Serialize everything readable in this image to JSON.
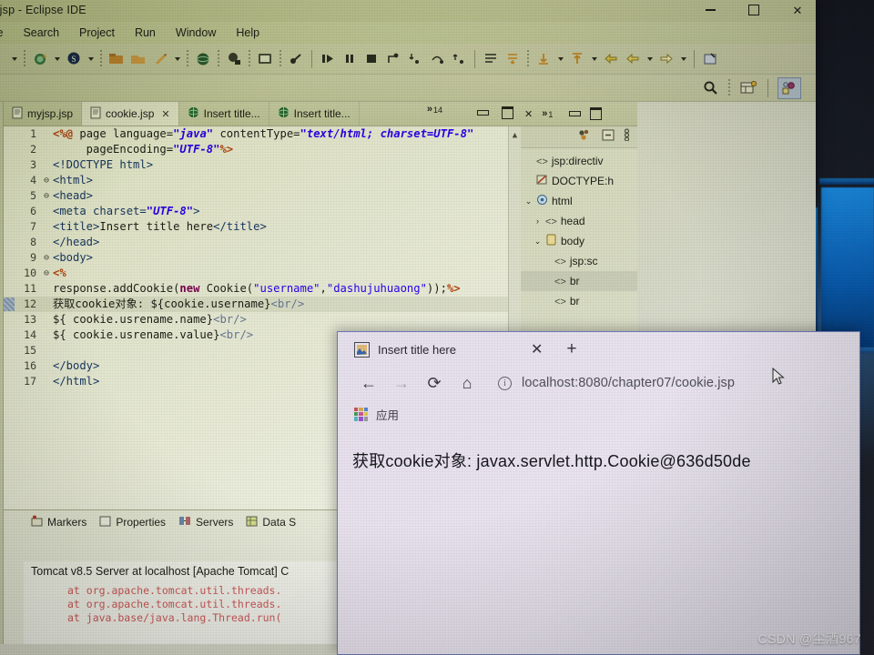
{
  "window": {
    "title": ".jsp - Eclipse IDE",
    "minimize_label": "Minimize",
    "maximize_label": "Maximize",
    "close_label": "✕"
  },
  "menu": {
    "items": [
      "te",
      "Search",
      "Project",
      "Run",
      "Window",
      "Help"
    ]
  },
  "perspective": {
    "search_icon": "search-icon",
    "open_perspective_icon": "open-perspective-icon",
    "active_perspective": "java-ee-perspective"
  },
  "editor": {
    "tabs": [
      {
        "label": "myjsp.jsp",
        "icon": "jsp-file-icon",
        "active": false,
        "closable": false
      },
      {
        "label": "cookie.jsp",
        "icon": "jsp-file-icon",
        "active": true,
        "closable": true,
        "close": "✕"
      },
      {
        "label": "Insert title...",
        "icon": "browser-globe-icon",
        "active": false,
        "closable": false
      },
      {
        "label": "Insert title...",
        "icon": "browser-globe-icon",
        "active": false,
        "closable": false
      }
    ],
    "overflow_chevron": "»",
    "overflow_count": "14",
    "lines": [
      {
        "n": "1",
        "fold": "",
        "html": "<span class=\"dir\">&lt;%@</span> <span class=\"plain\">page language=</span><span class=\"stri\">\"java\"</span><span class=\"plain\"> contentType=</span><span class=\"stri\">\"text/html; charset=UTF-8\"</span>"
      },
      {
        "n": "2",
        "fold": "",
        "html": "<span class=\"plain\">     pageEncoding=</span><span class=\"stri\">\"UTF-8\"</span><span class=\"dir\">%&gt;</span>"
      },
      {
        "n": "3",
        "fold": "",
        "html": "<span class=\"tag\">&lt;!DOCTYPE html&gt;</span>"
      },
      {
        "n": "4",
        "fold": "⊖",
        "html": "<span class=\"tag\">&lt;html&gt;</span>"
      },
      {
        "n": "5",
        "fold": "⊖",
        "html": "<span class=\"tag\">&lt;head&gt;</span>"
      },
      {
        "n": "6",
        "fold": "",
        "html": "<span class=\"tag\">&lt;meta charset=</span><span class=\"stri\">\"UTF-8\"</span><span class=\"tag\">&gt;</span>"
      },
      {
        "n": "7",
        "fold": "",
        "html": "<span class=\"tag\">&lt;title&gt;</span><span class=\"plain\">Insert title here</span><span class=\"tag\">&lt;/title&gt;</span>"
      },
      {
        "n": "8",
        "fold": "",
        "html": "<span class=\"tag\">&lt;/head&gt;</span>"
      },
      {
        "n": "9",
        "fold": "⊖",
        "html": "<span class=\"tag\">&lt;body&gt;</span>"
      },
      {
        "n": "10",
        "fold": "⊖",
        "html": "<span class=\"dir\">&lt;%</span>"
      },
      {
        "n": "11",
        "fold": "",
        "html": "<span class=\"plain\">response.addCookie(</span><span class=\"kw\">new</span><span class=\"plain\"> Cookie(</span><span class=\"str\">\"username\"</span><span class=\"plain\">,</span><span class=\"str\">\"dashujuhuaong\"</span><span class=\"plain\">));</span><span class=\"dir\">%&gt;</span>"
      },
      {
        "n": "12",
        "fold": "",
        "selected": true,
        "html": "<span class=\"plain\">获取cookie对象: ${cookie.username}</span><span class=\"tagd\">&lt;br/&gt;</span>"
      },
      {
        "n": "13",
        "fold": "",
        "html": "<span class=\"plain\">${ cookie.usrename.name}</span><span class=\"tagd\">&lt;br/&gt;</span>"
      },
      {
        "n": "14",
        "fold": "",
        "html": "<span class=\"plain\">${ cookie.usrename.value}</span><span class=\"tagd\">&lt;br/&gt;</span>"
      },
      {
        "n": "15",
        "fold": "",
        "html": ""
      },
      {
        "n": "16",
        "fold": "",
        "html": "<span class=\"tag\">&lt;/body&gt;</span>"
      },
      {
        "n": "17",
        "fold": "",
        "html": "<span class=\"tag\">&lt;/html&gt;</span>"
      }
    ]
  },
  "outline": {
    "view_close": "✕",
    "overflow_chevron": "»",
    "overflow_count": "1",
    "toolbar_icons": [
      "sort-icon",
      "collapse-all-icon",
      "view-menu-icon"
    ],
    "nodes": [
      {
        "label": "jsp:directiv",
        "indent": 0,
        "twisty": "",
        "icon": "angle-brackets-icon",
        "selected": false
      },
      {
        "label": "DOCTYPE:h",
        "indent": 0,
        "twisty": "",
        "icon": "doctype-icon",
        "selected": false
      },
      {
        "label": "html",
        "indent": 0,
        "twisty": "⌄",
        "icon": "html-element-icon",
        "selected": false
      },
      {
        "label": "head",
        "indent": 1,
        "twisty": "›",
        "icon": "angle-brackets-icon",
        "selected": false
      },
      {
        "label": "body",
        "indent": 1,
        "twisty": "⌄",
        "icon": "body-element-icon",
        "selected": false
      },
      {
        "label": "jsp:sc",
        "indent": 2,
        "twisty": "",
        "icon": "angle-brackets-icon",
        "selected": false
      },
      {
        "label": "br",
        "indent": 2,
        "twisty": "",
        "icon": "angle-brackets-icon",
        "selected": true
      },
      {
        "label": "br",
        "indent": 2,
        "twisty": "",
        "icon": "angle-brackets-icon",
        "selected": false
      }
    ]
  },
  "bottom_panel": {
    "tabs": [
      {
        "label": "Markers",
        "icon": "markers-icon"
      },
      {
        "label": "Properties",
        "icon": "properties-icon"
      },
      {
        "label": "Servers",
        "icon": "servers-icon"
      },
      {
        "label": "Data S",
        "icon": "data-source-icon"
      }
    ],
    "console_header": "Tomcat v8.5 Server at localhost [Apache Tomcat] C",
    "stack_lines": [
      "at org.apache.tomcat.util.threads.",
      "at org.apache.tomcat.util.threads.",
      "at java.base/java.lang.Thread.run("
    ]
  },
  "browser": {
    "tab": {
      "title": "Insert title here",
      "favicon": "page-favicon",
      "close": "✕"
    },
    "new_tab": "+",
    "nav": {
      "back": "←",
      "forward": "→",
      "reload": "⟳",
      "home": "⌂",
      "info": "i"
    },
    "url": "localhost:8080/chapter07/cookie.jsp",
    "bookmarks_label": "应用",
    "page_text": "获取cookie对象: javax.servlet.http.Cookie@636d50de"
  },
  "watermark": "CSDN @尘酒967",
  "colors": {
    "eclipse_chrome": "#cdd2a8",
    "editor_bg": "#eff1e2",
    "browser_bg": "#efeaf2",
    "keyword": "#7f0055",
    "string": "#2a00ff",
    "tag": "#1a3a6b",
    "directive": "#b8470f",
    "stack_red": "#d05a5a",
    "wallpaper_blue": "#1c8fe8"
  }
}
